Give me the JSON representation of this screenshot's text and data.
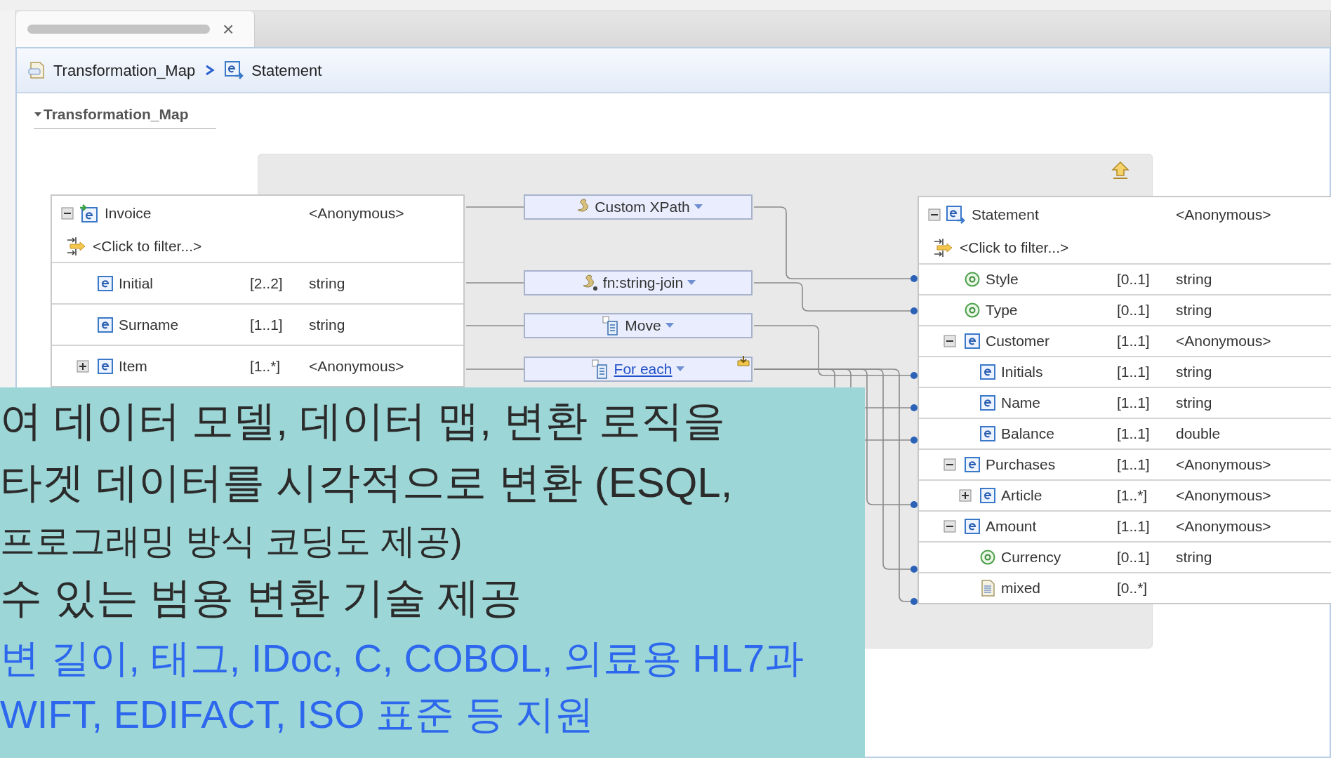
{
  "tab": {
    "close": "×"
  },
  "breadcrumb": [
    {
      "label": "Transformation_Map",
      "kind": "map"
    },
    {
      "label": "Statement",
      "kind": "element"
    }
  ],
  "section": {
    "title": "Transformation_Map",
    "expanded": true
  },
  "source": {
    "root": {
      "name": "Invoice",
      "type": "<Anonymous>",
      "expanded": true
    },
    "filter": "<Click to filter...>",
    "children": [
      {
        "kind": "element",
        "name": "Initial",
        "cardinality": "[2..2]",
        "type": "string"
      },
      {
        "kind": "element",
        "name": "Surname",
        "cardinality": "[1..1]",
        "type": "string"
      },
      {
        "kind": "element",
        "name": "Item",
        "cardinality": "[1..*]",
        "type": "<Anonymous>",
        "expanded": false
      }
    ]
  },
  "transforms": [
    {
      "label": "Custom XPath",
      "kind": "xpath"
    },
    {
      "label": "fn:string-join",
      "kind": "function"
    },
    {
      "label": "Move",
      "kind": "move"
    },
    {
      "label": "For each",
      "kind": "foreach"
    }
  ],
  "target": {
    "root": {
      "name": "Statement",
      "type": "<Anonymous>",
      "expanded": true
    },
    "filter": "<Click to filter...>",
    "children": [
      {
        "kind": "attribute",
        "name": "Style",
        "cardinality": "[0..1]",
        "type": "string",
        "mapped": true
      },
      {
        "kind": "attribute",
        "name": "Type",
        "cardinality": "[0..1]",
        "type": "string",
        "mapped": true
      },
      {
        "kind": "element",
        "name": "Customer",
        "cardinality": "[1..1]",
        "type": "<Anonymous>",
        "expanded": true,
        "mapped": false,
        "children": [
          {
            "kind": "element",
            "name": "Initials",
            "cardinality": "[1..1]",
            "type": "string",
            "mapped": true
          },
          {
            "kind": "element",
            "name": "Name",
            "cardinality": "[1..1]",
            "type": "string",
            "mapped": true
          },
          {
            "kind": "element",
            "name": "Balance",
            "cardinality": "[1..1]",
            "type": "double",
            "mapped": true
          }
        ]
      },
      {
        "kind": "element",
        "name": "Purchases",
        "cardinality": "[1..1]",
        "type": "<Anonymous>",
        "expanded": true,
        "mapped": false,
        "children": [
          {
            "kind": "element",
            "name": "Article",
            "cardinality": "[1..*]",
            "type": "<Anonymous>",
            "expanded": false,
            "mapped": true
          }
        ]
      },
      {
        "kind": "element",
        "name": "Amount",
        "cardinality": "[1..1]",
        "type": "<Anonymous>",
        "expanded": true,
        "mapped": false,
        "children": [
          {
            "kind": "attribute",
            "name": "Currency",
            "cardinality": "[0..1]",
            "type": "string",
            "mapped": true
          },
          {
            "kind": "mixed",
            "name": "mixed",
            "cardinality": "[0..*]",
            "mapped": true
          }
        ]
      }
    ]
  },
  "caption": [
    {
      "text": "여 데이터 모델, 데이터 맵, 변환 로직을",
      "kind": "large"
    },
    {
      "text": "타겟 데이터를 시각적으로 변환 (ESQL,",
      "kind": "large"
    },
    {
      "text": "프로그래밍 방식 코딩도 제공)",
      "kind": "small"
    },
    {
      "text": "수 있는 범용 변환 기술 제공",
      "kind": "large"
    },
    {
      "text": "변 길이, 태그, IDoc, C, COBOL, 의료용 HL7과",
      "kind": "blue"
    },
    {
      "text": "WIFT, EDIFACT, ISO 표준 등 지원",
      "kind": "blue"
    }
  ]
}
